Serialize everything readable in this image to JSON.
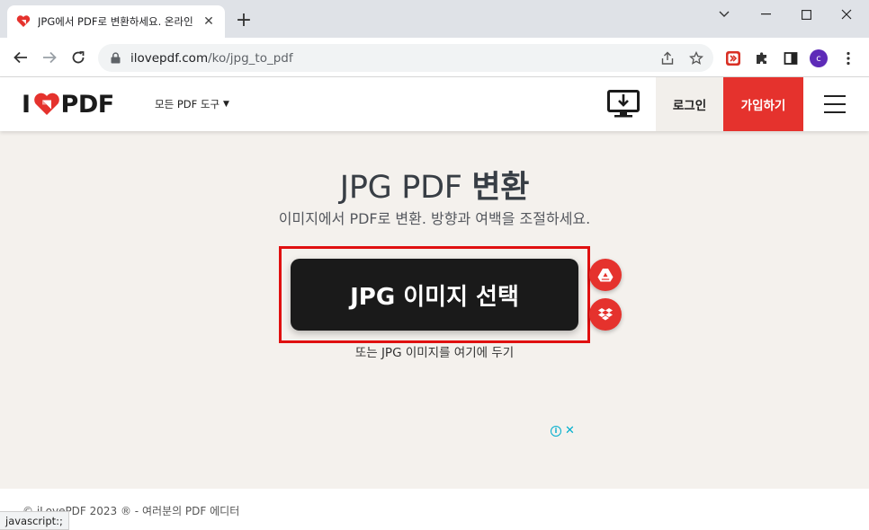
{
  "browser": {
    "tab": {
      "title": "JPG에서 PDF로 변환하세요. 온라인"
    },
    "url": {
      "domain": "ilovepdf.com",
      "path": "/ko/jpg_to_pdf"
    },
    "avatar_letter": "c"
  },
  "header": {
    "logo": {
      "left": "I",
      "right": "PDF"
    },
    "tools_menu": "모든 PDF 도구",
    "login": "로그인",
    "signup": "가입하기"
  },
  "main": {
    "title_light": "JPG PDF",
    "title_bold": "변환",
    "subtitle": "이미지에서 PDF로 변환. 방향과 여백을 조절하세요.",
    "select_button": "JPG 이미지 선택",
    "drop_hint": "또는 JPG 이미지를 여기에 두기"
  },
  "footer": {
    "text": "© iLovePDF 2023 ® - 여러분의 PDF 에디터"
  },
  "status_bar": "javascript:;",
  "colors": {
    "brand_red": "#e5322d",
    "dark_button": "#1a1a1a",
    "page_bg": "#f4f1ed",
    "highlight_border": "#e01010"
  }
}
